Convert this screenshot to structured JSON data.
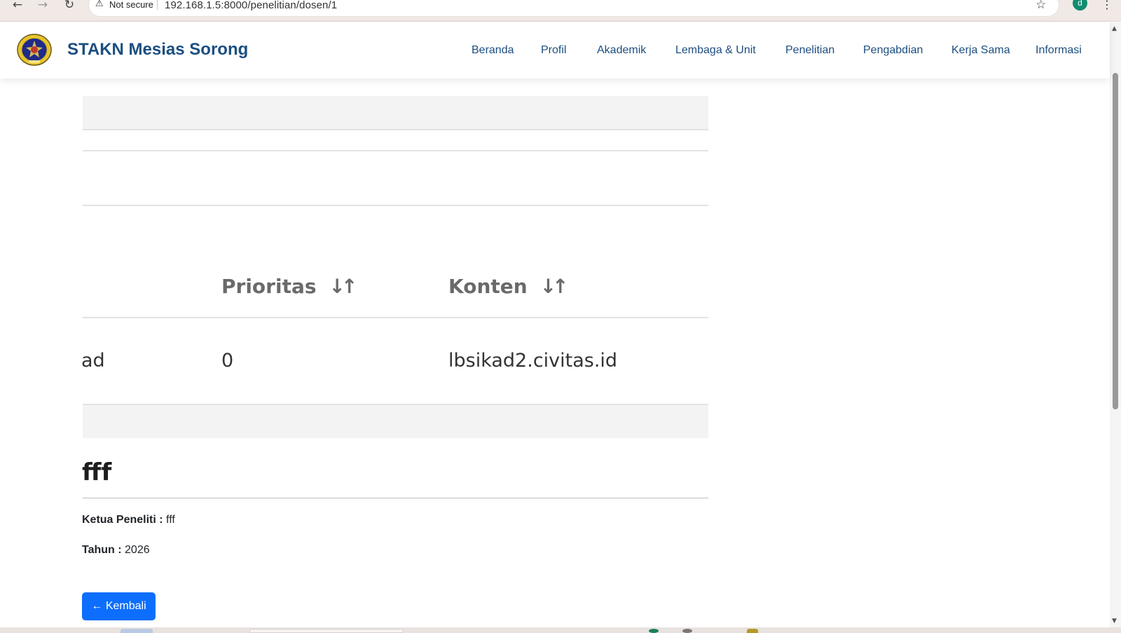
{
  "browser": {
    "security_label": "Not secure",
    "url": "192.168.1.5:8000/penelitian/dosen/1",
    "profile_initial": "d"
  },
  "site": {
    "brand": "STAKN Mesias Sorong",
    "nav": [
      "Beranda",
      "Profil",
      "Akademik",
      "Lembaga & Unit",
      "Penelitian",
      "Pengabdian",
      "Kerja Sama",
      "Informasi"
    ]
  },
  "table": {
    "headers": [
      "Prioritas",
      "Konten"
    ],
    "row": {
      "partial_cell": "ad",
      "prioritas": "0",
      "konten": "lbsikad2.civitas.id"
    }
  },
  "detail": {
    "title": "fff",
    "ketua_label": "Ketua Peneliti :",
    "ketua_value": "fff",
    "tahun_label": "Tahun :",
    "tahun_value": "2026",
    "back_label": "← Kembali"
  },
  "colors": {
    "brand": "#1c4e80",
    "primary": "#0d6efd"
  }
}
